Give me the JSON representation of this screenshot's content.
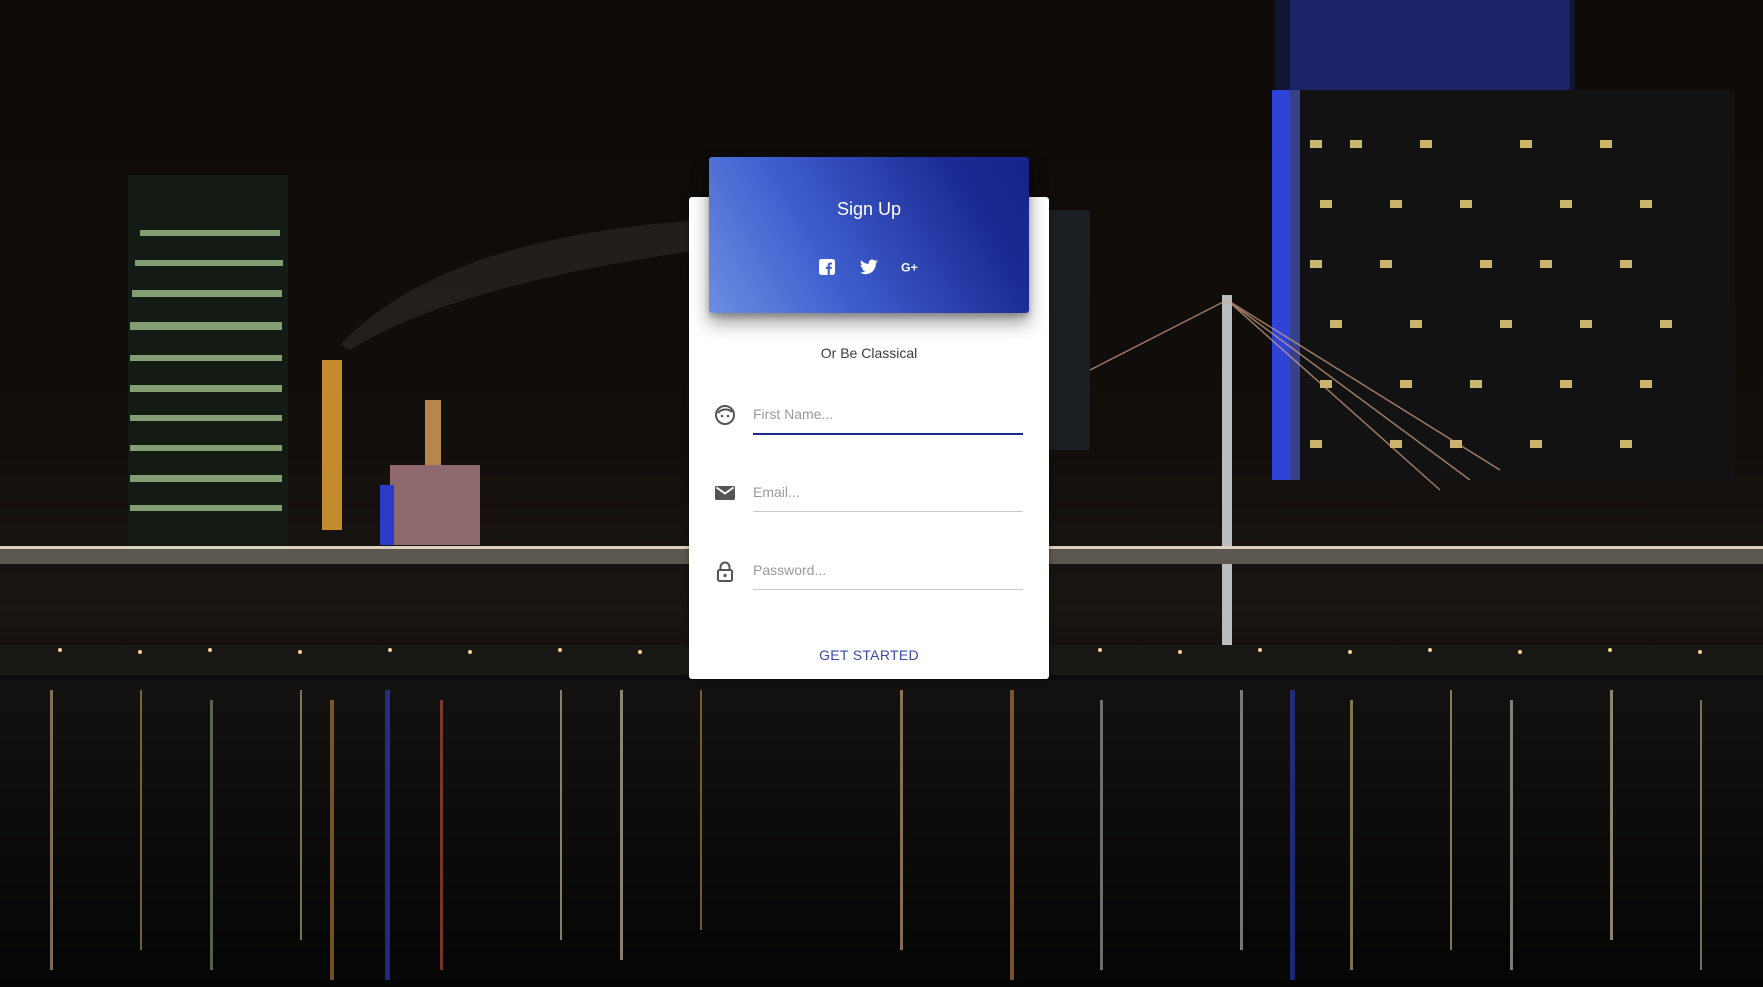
{
  "colors": {
    "header_gradient_start": "#6a8fe0",
    "header_gradient_end": "#16238a",
    "active_underline": "#1c2a8f",
    "button_text": "#3949ab"
  },
  "card": {
    "title": "Sign Up",
    "social": [
      {
        "name": "facebook",
        "icon": "facebook-icon"
      },
      {
        "name": "twitter",
        "icon": "twitter-icon"
      },
      {
        "name": "google-plus",
        "icon": "google-plus-icon"
      }
    ],
    "subtitle": "Or Be Classical",
    "fields": {
      "first_name": {
        "icon": "face-icon",
        "placeholder": "First Name...",
        "value": ""
      },
      "email": {
        "icon": "email-icon",
        "placeholder": "Email...",
        "value": ""
      },
      "password": {
        "icon": "lock-icon",
        "placeholder": "Password...",
        "value": ""
      }
    },
    "submit_label": "GET STARTED"
  }
}
